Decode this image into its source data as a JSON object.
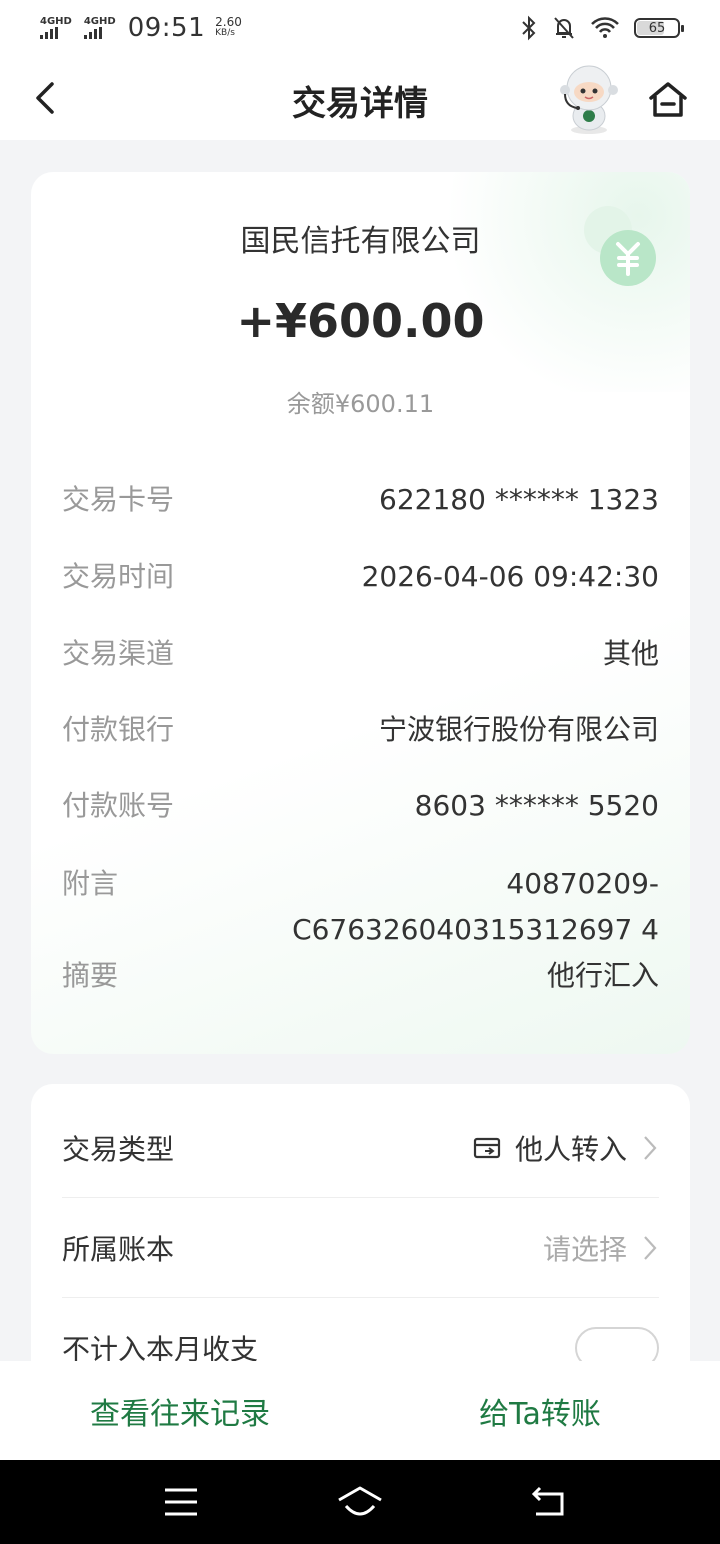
{
  "status_bar": {
    "network1": "4GHD",
    "network2": "4GHD",
    "time": "09:51",
    "speed_value": "2.60",
    "speed_unit": "KB/s",
    "battery": "65"
  },
  "header": {
    "title": "交易详情"
  },
  "summary": {
    "payee": "国民信托有限公司",
    "amount": "+¥600.00",
    "balance": "余额¥600.11"
  },
  "details": [
    {
      "label": "交易卡号",
      "value": "622180 ****** 1323"
    },
    {
      "label": "交易时间",
      "value": "2026-04-06 09:42:30"
    },
    {
      "label": "交易渠道",
      "value": "其他"
    },
    {
      "label": "付款银行",
      "value": "宁波银行股份有限公司"
    },
    {
      "label": "付款账号",
      "value": "8603 ****** 5520"
    },
    {
      "label": "附言",
      "value_line1": "40870209-",
      "value_line2": "C676326040315312697 4"
    },
    {
      "label": "摘要",
      "value": "他行汇入"
    }
  ],
  "options": {
    "type_label": "交易类型",
    "type_value": "他人转入",
    "book_label": "所属账本",
    "book_placeholder": "请选择",
    "exclude_label": "不计入本月收支"
  },
  "actions": {
    "history": "查看往来记录",
    "transfer": "给Ta转账"
  },
  "colors": {
    "accent_green": "#1f7a43",
    "coin_green": "#b9e6c8"
  }
}
